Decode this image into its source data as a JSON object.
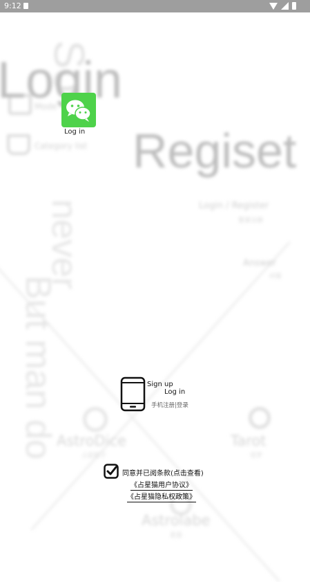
{
  "status_bar": {
    "time": "9:12"
  },
  "background": {
    "title_login": "Login",
    "title_regiset": "Regiset",
    "vertical_texts": [
      "So",
      "never",
      "But man do"
    ],
    "menu_items": [
      "Mode",
      "Category list"
    ],
    "right_items": [
      {
        "label": "Login / Register",
        "sub": "登录注册"
      },
      {
        "label": "Answer",
        "sub": "问答"
      }
    ],
    "bottom_items": [
      {
        "label": "AstroDice",
        "sub": "占星骰子"
      },
      {
        "label": "Tarot",
        "sub": "塔罗"
      },
      {
        "label": "Astrolabe",
        "sub": "星盘"
      }
    ]
  },
  "wechat_login": {
    "label": "Log in"
  },
  "phone_login": {
    "signup": "Sign up",
    "login": "Log in",
    "sub": "手机注册|登录"
  },
  "agreement": {
    "text": "同意并已阅条款(点击查看)",
    "user_agreement": "《占星猫用户协议》",
    "privacy_policy": "《占星猫隐私权政策》"
  },
  "colors": {
    "wechat_green": "#4ed24a",
    "status_bar": "#9e9e9e"
  }
}
